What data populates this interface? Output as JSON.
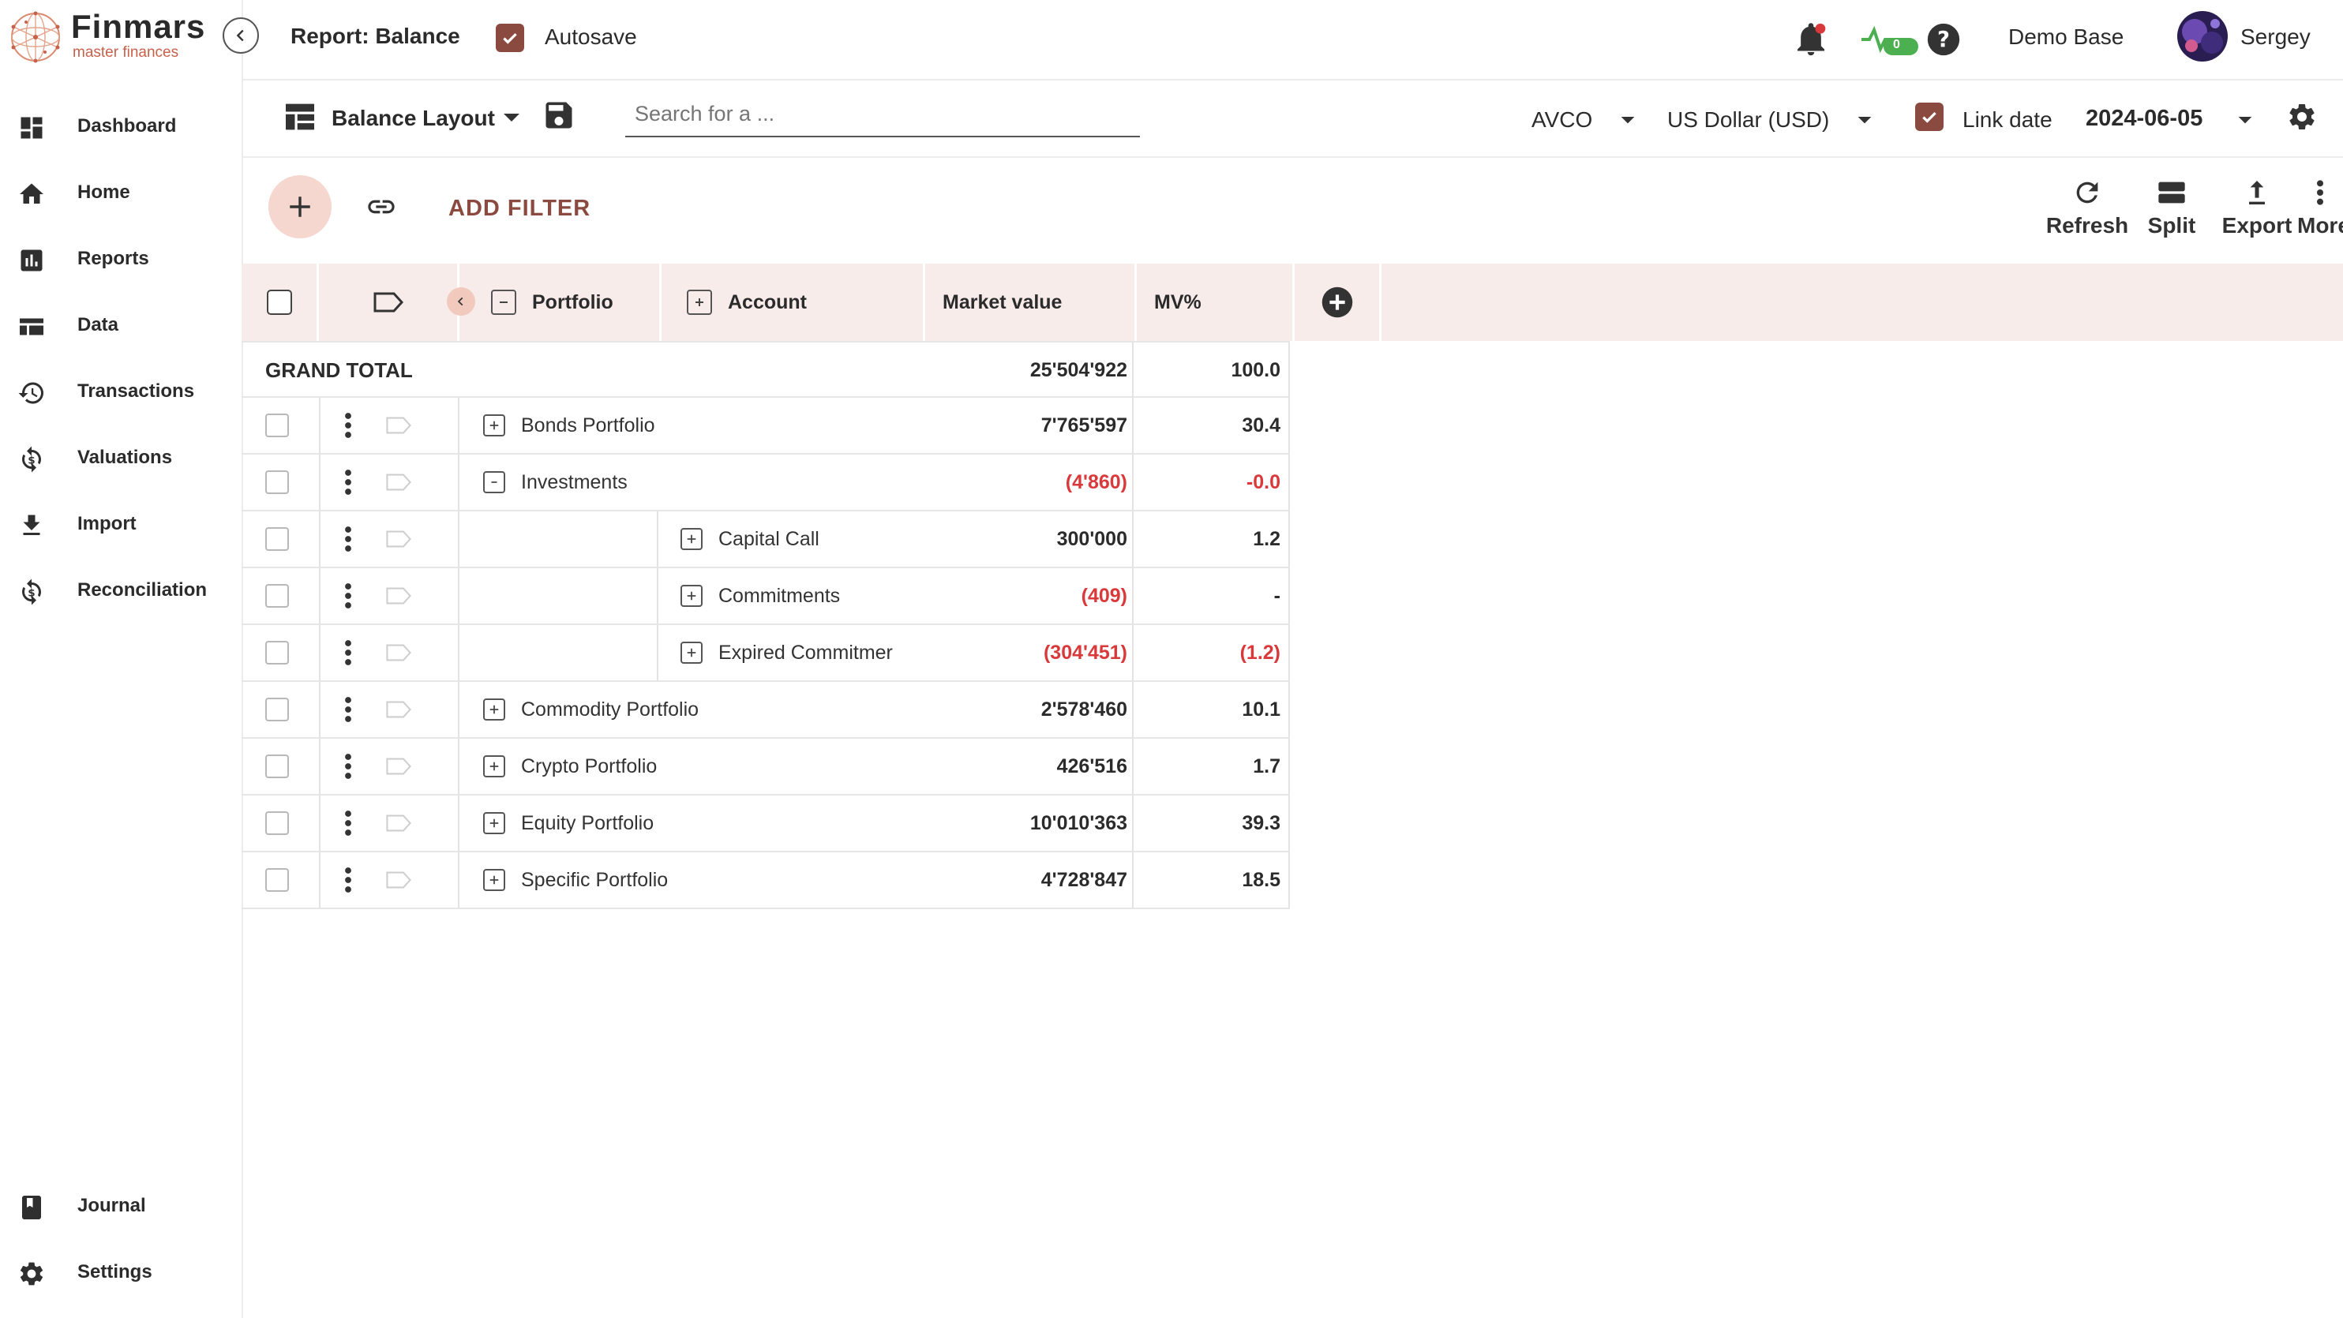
{
  "app": {
    "brand_name": "Finmars",
    "brand_tagline": "master finances",
    "report_title": "Report: Balance",
    "autosave_label": "Autosave",
    "notifications_badge": "0",
    "base_name": "Demo Base",
    "user_name": "Sergey"
  },
  "sidebar": {
    "items": [
      {
        "label": "Dashboard",
        "icon": "dashboard-icon"
      },
      {
        "label": "Home",
        "icon": "home-icon"
      },
      {
        "label": "Reports",
        "icon": "reports-icon"
      },
      {
        "label": "Data",
        "icon": "data-icon"
      },
      {
        "label": "Transactions",
        "icon": "history-icon"
      },
      {
        "label": "Valuations",
        "icon": "valuations-icon"
      },
      {
        "label": "Import",
        "icon": "download-icon"
      },
      {
        "label": "Reconciliation",
        "icon": "reconciliation-icon"
      }
    ],
    "bottom_items": [
      {
        "label": "Journal",
        "icon": "journal-icon"
      },
      {
        "label": "Settings",
        "icon": "gear-icon"
      }
    ]
  },
  "layoutbar": {
    "layout_name": "Balance Layout",
    "search_placeholder": "Search for a ...",
    "cost_method": "AVCO",
    "currency": "US Dollar (USD)",
    "link_date_label": "Link date",
    "date": "2024-06-05"
  },
  "actionbar": {
    "add_filter_label": "ADD FILTER",
    "tools": [
      {
        "label": "Refresh",
        "icon": "refresh-icon"
      },
      {
        "label": "Split",
        "icon": "split-icon"
      },
      {
        "label": "Export",
        "icon": "export-icon"
      },
      {
        "label": "More",
        "icon": "more-vert-icon"
      }
    ]
  },
  "table": {
    "columns": {
      "portfolio": "Portfolio",
      "account": "Account",
      "market_value": "Market value",
      "mv_pct": "MV%"
    },
    "grand_total": {
      "label": "GRAND TOTAL",
      "market_value": "25'504'922",
      "mv_pct": "100.0"
    },
    "rows": [
      {
        "level": 1,
        "expander": "+",
        "label": "Bonds Portfolio",
        "market_value": "7'765'597",
        "mv_pct": "30.4",
        "mv_negative": false,
        "pct_negative": false
      },
      {
        "level": 1,
        "expander": "-",
        "label": "Investments",
        "market_value": "(4'860)",
        "mv_pct": "-0.0",
        "mv_negative": true,
        "pct_negative": true
      },
      {
        "level": 2,
        "expander": "+",
        "label": "Capital Call",
        "market_value": "300'000",
        "mv_pct": "1.2",
        "mv_negative": false,
        "pct_negative": false
      },
      {
        "level": 2,
        "expander": "+",
        "label": "Commitments",
        "market_value": "(409)",
        "mv_pct": "-",
        "mv_negative": true,
        "pct_negative": false
      },
      {
        "level": 2,
        "expander": "+",
        "label": "Expired Commitmer",
        "market_value": "(304'451)",
        "mv_pct": "(1.2)",
        "mv_negative": true,
        "pct_negative": true
      },
      {
        "level": 1,
        "expander": "+",
        "label": "Commodity Portfolio",
        "market_value": "2'578'460",
        "mv_pct": "10.1",
        "mv_negative": false,
        "pct_negative": false
      },
      {
        "level": 1,
        "expander": "+",
        "label": "Crypto Portfolio",
        "market_value": "426'516",
        "mv_pct": "1.7",
        "mv_negative": false,
        "pct_negative": false
      },
      {
        "level": 1,
        "expander": "+",
        "label": "Equity Portfolio",
        "market_value": "10'010'363",
        "mv_pct": "39.3",
        "mv_negative": false,
        "pct_negative": false
      },
      {
        "level": 1,
        "expander": "+",
        "label": "Specific Portfolio",
        "market_value": "4'728'847",
        "mv_pct": "18.5",
        "mv_negative": false,
        "pct_negative": false
      }
    ]
  },
  "colors": {
    "accent": "#8b4a3f",
    "brand": "#c8614a",
    "negative": "#d9393a",
    "header_bg": "#f8eceb",
    "add_button_bg": "#f6d7cf",
    "status_green": "#4caf50"
  }
}
